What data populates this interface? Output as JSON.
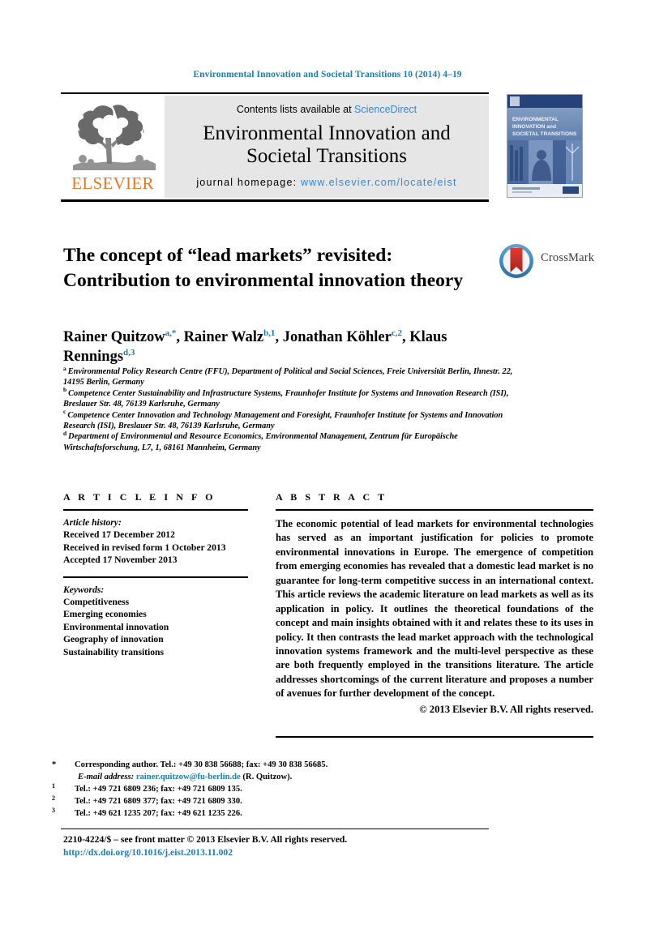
{
  "running_head": "Environmental Innovation and Societal Transitions 10 (2014) 4–19",
  "masthead": {
    "contents_prefix": "Contents lists available at ",
    "sciencedirect": "ScienceDirect",
    "journal_name_line1": "Environmental Innovation and",
    "journal_name_line2": "Societal Transitions",
    "homepage_prefix": "journal homepage: ",
    "homepage_url": "www.elsevier.com/locate/eist",
    "publisher": "ELSEVIER",
    "publisher_color": "#e87722",
    "link_color": "#3a86c8",
    "cover": {
      "line1": "ENVIRONMENTAL",
      "line2": "INNOVATION and",
      "line3": "SOCIETAL TRANSITIONS"
    }
  },
  "article": {
    "title": "The concept of “lead markets” revisited: Contribution to environmental innovation theory",
    "authors_html": "authors rendered with superscript markers",
    "authors": [
      {
        "name": "Rainer Quitzow",
        "marks": "a,*"
      },
      {
        "name": "Rainer Walz",
        "marks": "b,1"
      },
      {
        "name": "Jonathan Köhler",
        "marks": "c,2"
      },
      {
        "name": "Klaus Rennings",
        "marks": "d,3"
      }
    ],
    "crossmark_label": "CrossMark",
    "affiliations": [
      {
        "mark": "a",
        "text": "Environmental Policy Research Centre (FFU), Department of Political and Social Sciences, Freie Universität Berlin, Ihnestr. 22, 14195 Berlin, Germany"
      },
      {
        "mark": "b",
        "text": "Competence Center Sustainability and Infrastructure Systems, Fraunhofer Institute for Systems and Innovation Research (ISI), Breslauer Str. 48, 76139 Karlsruhe, Germany"
      },
      {
        "mark": "c",
        "text": "Competence Center Innovation and Technology Management and Foresight, Fraunhofer Institute for Systems and Innovation Research (ISI), Breslauer Str. 48, 76139 Karlsruhe, Germany"
      },
      {
        "mark": "d",
        "text": "Department of Environmental and Resource Economics, Environmental Management, Zentrum für Europäische Wirtschaftsforschung, L7, 1, 68161 Mannheim, Germany"
      }
    ]
  },
  "article_info": {
    "heading": "A R T I C L E   I N F O",
    "history_label": "Article history:",
    "history": [
      "Received 17 December 2012",
      "Received in revised form 1 October 2013",
      "Accepted 17 November 2013"
    ],
    "keywords_label": "Keywords:",
    "keywords": [
      "Competitiveness",
      "Emerging economies",
      "Environmental innovation",
      "Geography of innovation",
      "Sustainability transitions"
    ]
  },
  "abstract": {
    "heading": "A B S T R A C T",
    "text": "The economic potential of lead markets for environmental technologies has served as an important justification for policies to promote environmental innovations in Europe. The emergence of competition from emerging economies has revealed that a domestic lead market is no guarantee for long-term competitive success in an international context. This article reviews the academic literature on lead markets as well as its application in policy. It outlines the theoretical foundations of the concept and main insights obtained with it and relates these to its uses in policy. It then contrasts the lead market approach with the technological innovation systems framework and the multi-level perspective as these are both frequently employed in the transitions literature. The article addresses shortcomings of the current literature and proposes a number of avenues for further development of the concept.",
    "copyright": "© 2013 Elsevier B.V. All rights reserved."
  },
  "footnotes": {
    "corresponding": "Corresponding author. Tel.: +49 30 838 56688; fax: +49 30 838 56685.",
    "email_label": "E-mail address:",
    "email": "rainer.quitzow@fu-berlin.de",
    "email_suffix": "(R. Quitzow).",
    "numbered": [
      {
        "mark": "1",
        "text": "Tel.: +49 721 6809 236; fax: +49 721 6809 135."
      },
      {
        "mark": "2",
        "text": "Tel.: +49 721 6809 377; fax: +49 721 6809 330."
      },
      {
        "mark": "3",
        "text": "Tel.: +49 621 1235 207; fax: +49 621 1235 226."
      }
    ]
  },
  "front_matter": {
    "line": "2210-4224/$ – see front matter © 2013 Elsevier B.V. All rights reserved.",
    "doi": "http://dx.doi.org/10.1016/j.eist.2013.11.002"
  }
}
